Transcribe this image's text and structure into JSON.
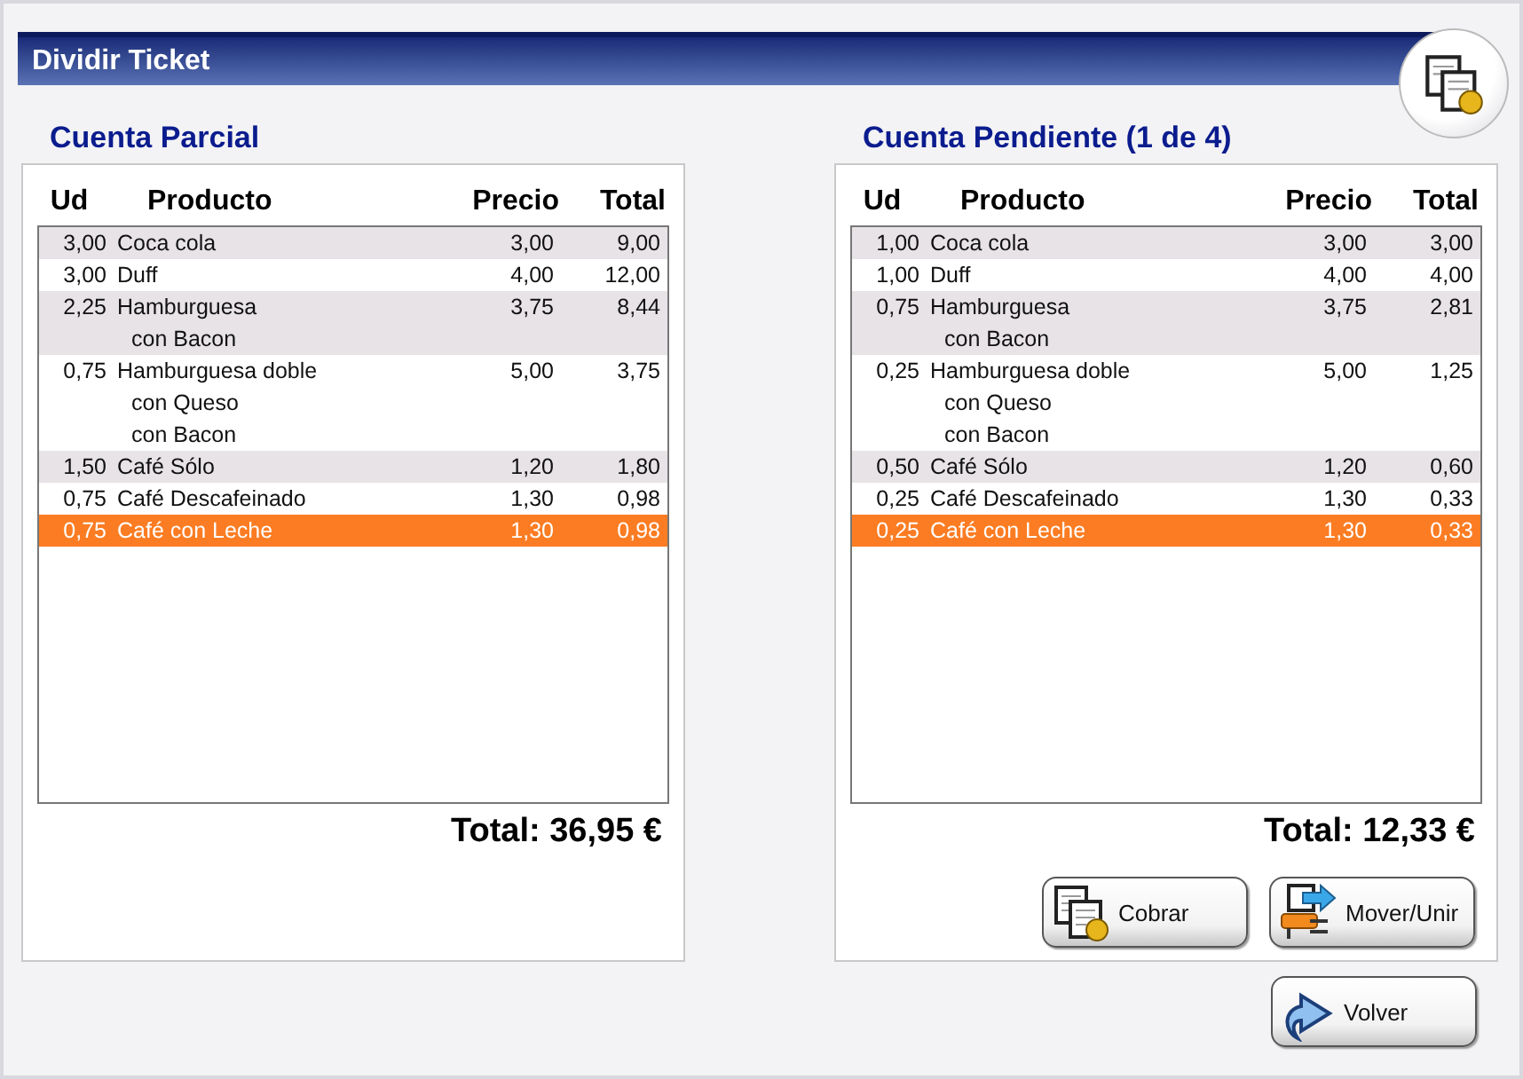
{
  "window": {
    "title": "Dividir Ticket"
  },
  "accounts": [
    {
      "heading": "Cuenta Parcial",
      "columns": [
        "Ud",
        "Producto",
        "Precio",
        "Total"
      ],
      "rows": [
        {
          "ud": "3,00",
          "product": "Coca cola",
          "price": "3,00",
          "total": "9,00",
          "selected": false
        },
        {
          "ud": "3,00",
          "product": "Duff",
          "price": "4,00",
          "total": "12,00",
          "selected": false
        },
        {
          "ud": "2,25",
          "product": "Hamburguesa",
          "modifiers": [
            "con Bacon"
          ],
          "price": "3,75",
          "total": "8,44",
          "selected": false
        },
        {
          "ud": "0,75",
          "product": "Hamburguesa doble",
          "modifiers": [
            "con Queso",
            "con Bacon"
          ],
          "price": "5,00",
          "total": "3,75",
          "selected": false
        },
        {
          "ud": "1,50",
          "product": "Café Sólo",
          "price": "1,20",
          "total": "1,80",
          "selected": false
        },
        {
          "ud": "0,75",
          "product": "Café Descafeinado",
          "price": "1,30",
          "total": "0,98",
          "selected": false
        },
        {
          "ud": "0,75",
          "product": "Café con Leche",
          "price": "1,30",
          "total": "0,98",
          "selected": true
        }
      ],
      "total": "Total: 36,95 €"
    },
    {
      "heading": "Cuenta Pendiente (1 de 4)",
      "columns": [
        "Ud",
        "Producto",
        "Precio",
        "Total"
      ],
      "rows": [
        {
          "ud": "1,00",
          "product": "Coca cola",
          "price": "3,00",
          "total": "3,00",
          "selected": false
        },
        {
          "ud": "1,00",
          "product": "Duff",
          "price": "4,00",
          "total": "4,00",
          "selected": false
        },
        {
          "ud": "0,75",
          "product": "Hamburguesa",
          "modifiers": [
            "con Bacon"
          ],
          "price": "3,75",
          "total": "2,81",
          "selected": false
        },
        {
          "ud": "0,25",
          "product": "Hamburguesa doble",
          "modifiers": [
            "con Queso",
            "con Bacon"
          ],
          "price": "5,00",
          "total": "1,25",
          "selected": false
        },
        {
          "ud": "0,50",
          "product": "Café Sólo",
          "price": "1,20",
          "total": "0,60",
          "selected": false
        },
        {
          "ud": "0,25",
          "product": "Café Descafeinado",
          "price": "1,30",
          "total": "0,33",
          "selected": false
        },
        {
          "ud": "0,25",
          "product": "Café con Leche",
          "price": "1,30",
          "total": "0,33",
          "selected": true
        }
      ],
      "total": "Total: 12,33 €",
      "buttons": [
        {
          "label": "Cobrar",
          "kind": "pay"
        },
        {
          "label": "Mover/Unir",
          "kind": "move"
        }
      ]
    }
  ],
  "footer_button": {
    "label": "Volver",
    "kind": "back"
  }
}
